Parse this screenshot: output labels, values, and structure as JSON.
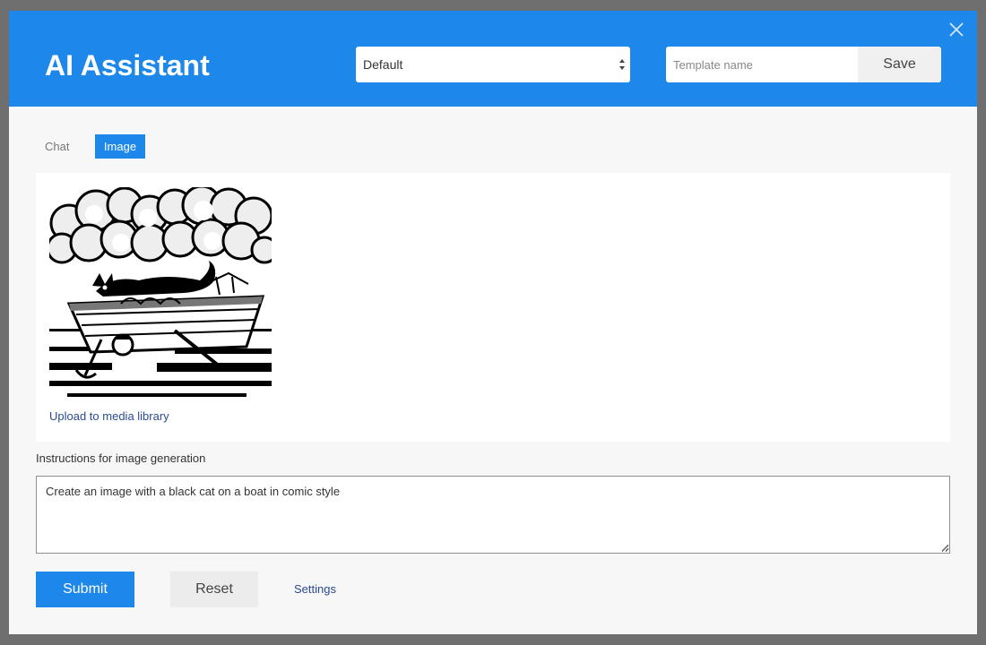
{
  "header": {
    "title": "AI Assistant",
    "close_icon": "close-icon",
    "template_select": {
      "selected": "Default"
    },
    "template_name": {
      "placeholder": "Template name",
      "value": ""
    },
    "save_label": "Save"
  },
  "tabs": [
    {
      "label": "Chat",
      "active": false
    },
    {
      "label": "Image",
      "active": true
    }
  ],
  "image_panel": {
    "upload_label": "Upload to media library"
  },
  "instructions": {
    "label": "Instructions for image generation",
    "value": "Create an image with a black cat on a boat in comic style"
  },
  "actions": {
    "submit_label": "Submit",
    "reset_label": "Reset",
    "settings_label": "Settings"
  },
  "colors": {
    "accent": "#1e88ea",
    "link": "#2b4a96",
    "backdrop": "#6f6f6f",
    "modal_bg": "#f7f7f7"
  }
}
